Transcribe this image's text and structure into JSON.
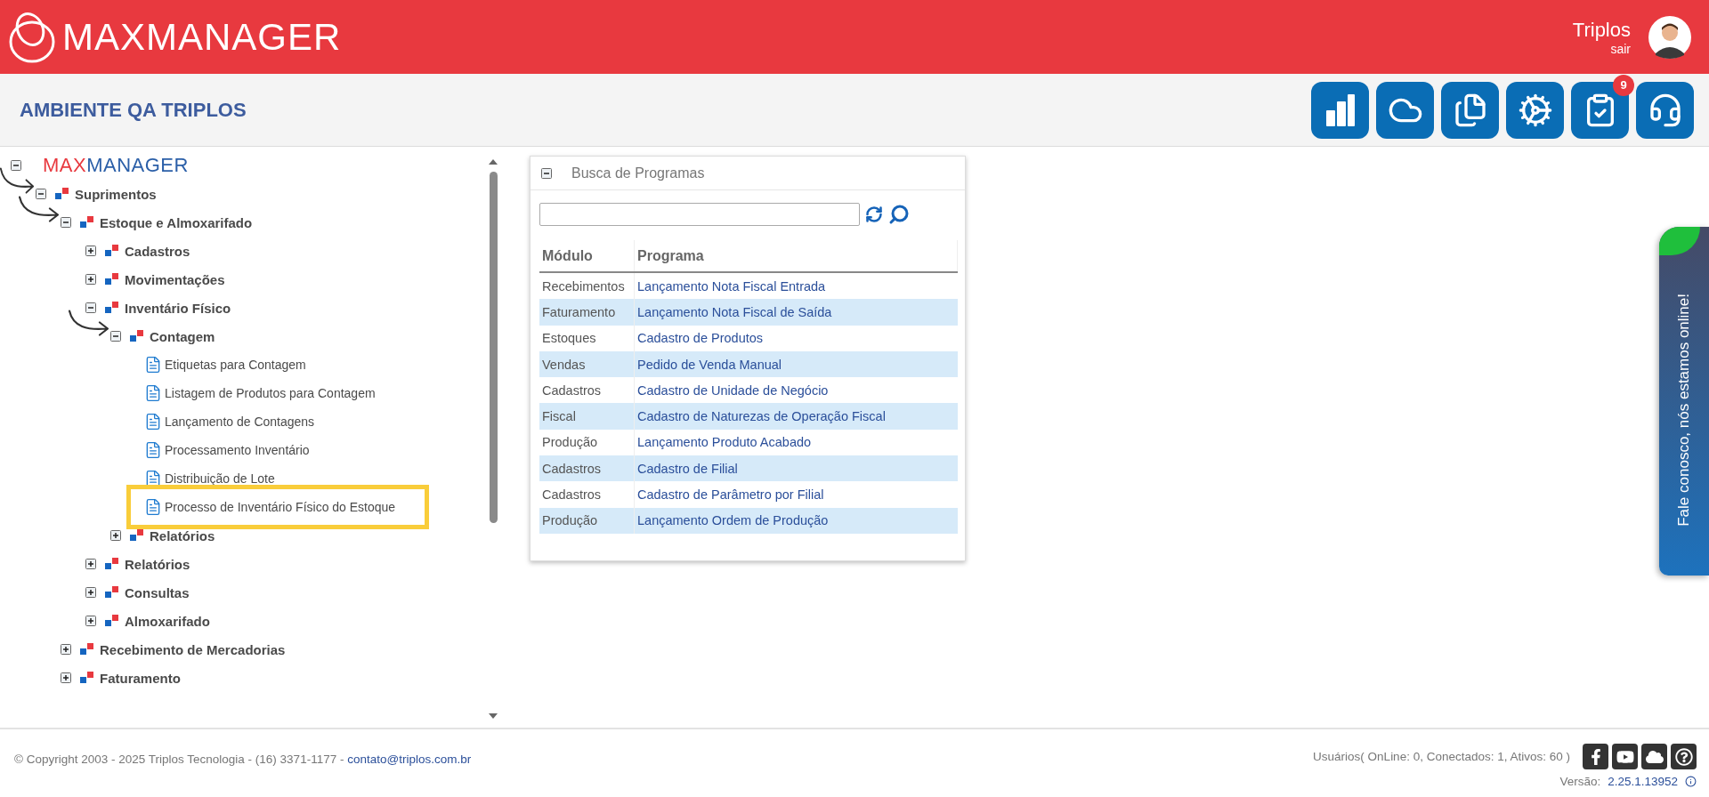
{
  "header": {
    "brand": "MAXMANAGER",
    "user_name": "Triplos",
    "logout": "sair"
  },
  "subbar": {
    "title": "AMBIENTE QA TRIPLOS",
    "tools": [
      {
        "kind": "reports"
      },
      {
        "kind": "api"
      },
      {
        "kind": "documents"
      },
      {
        "kind": "scheduler"
      },
      {
        "kind": "tasks",
        "badge": "9"
      },
      {
        "kind": "support"
      }
    ]
  },
  "tree": {
    "root": {
      "brand_prefix": "MAX",
      "brand_suffix": "MANAGER",
      "expanded": true
    },
    "items": [
      {
        "label": "Suprimentos",
        "kind": "folder",
        "expanded": true,
        "arrow": true,
        "highlighted": false,
        "children": [
          {
            "label": "Estoque e Almoxarifado",
            "kind": "folder",
            "expanded": true,
            "arrow": true,
            "highlighted": false,
            "children": [
              {
                "label": "Cadastros",
                "kind": "folder",
                "expanded": false,
                "arrow": false,
                "highlighted": false
              },
              {
                "label": "Movimentações",
                "kind": "folder",
                "expanded": false,
                "arrow": false,
                "highlighted": false
              },
              {
                "label": "Inventário Físico",
                "kind": "folder",
                "expanded": true,
                "arrow": false,
                "highlighted": false,
                "children": [
                  {
                    "label": "Contagem",
                    "kind": "folder",
                    "expanded": true,
                    "arrow": true,
                    "highlighted": false,
                    "children": [
                      {
                        "label": "Etiquetas para Contagem",
                        "kind": "program",
                        "arrow": false,
                        "highlighted": false
                      },
                      {
                        "label": "Listagem de Produtos para Contagem",
                        "kind": "program",
                        "arrow": false,
                        "highlighted": false
                      },
                      {
                        "label": "Lançamento de Contagens",
                        "kind": "program",
                        "arrow": false,
                        "highlighted": false
                      },
                      {
                        "label": "Processamento Inventário",
                        "kind": "program",
                        "arrow": false,
                        "highlighted": false
                      },
                      {
                        "label": "Distribuição de Lote",
                        "kind": "program",
                        "arrow": false,
                        "highlighted": false
                      },
                      {
                        "label": "Processo de Inventário Físico do Estoque",
                        "kind": "program",
                        "arrow": false,
                        "highlighted": true
                      }
                    ]
                  },
                  {
                    "label": "Relatórios",
                    "kind": "folder",
                    "expanded": false,
                    "arrow": false,
                    "highlighted": false
                  }
                ]
              },
              {
                "label": "Relatórios",
                "kind": "folder",
                "expanded": false,
                "arrow": false,
                "highlighted": false
              },
              {
                "label": "Consultas",
                "kind": "folder",
                "expanded": false,
                "arrow": false,
                "highlighted": false
              },
              {
                "label": "Almoxarifado",
                "kind": "folder",
                "expanded": false,
                "arrow": false,
                "highlighted": false
              }
            ]
          },
          {
            "label": "Recebimento de Mercadorias",
            "kind": "folder",
            "expanded": false,
            "arrow": false,
            "highlighted": false
          },
          {
            "label": "Faturamento",
            "kind": "folder",
            "expanded": false,
            "arrow": false,
            "highlighted": false
          }
        ]
      }
    ]
  },
  "search_panel": {
    "title": "Busca de Programas",
    "expanded": true,
    "columns": [
      "Módulo",
      "Programa"
    ],
    "rows": [
      [
        "Recebimentos",
        "Lançamento Nota Fiscal Entrada"
      ],
      [
        "Faturamento",
        "Lançamento Nota Fiscal de Saída"
      ],
      [
        "Estoques",
        "Cadastro de Produtos"
      ],
      [
        "Vendas",
        "Pedido de Venda Manual"
      ],
      [
        "Cadastros",
        "Cadastro de Unidade de Negócio"
      ],
      [
        "Fiscal",
        "Cadastro de Naturezas de Operação Fiscal"
      ],
      [
        "Produção",
        "Lançamento Produto Acabado"
      ],
      [
        "Cadastros",
        "Cadastro de Filial"
      ],
      [
        "Cadastros",
        "Cadastro de Parâmetro por Filial"
      ],
      [
        "Produção",
        "Lançamento Ordem de Produção"
      ]
    ]
  },
  "chat_tab": {
    "label": "Fale conosco, nós estamos online!",
    "online": true
  },
  "footer": {
    "copyright": "© Copyright 2003 - 2025 Triplos Tecnologia - (16) 3371-1177 - ",
    "email": "contato@triplos.com.br",
    "users": "Usuários( OnLine: 0, Conectados: 1, Ativos: 60 )",
    "version_label": "Versão:",
    "version": "2.25.1.13952"
  }
}
